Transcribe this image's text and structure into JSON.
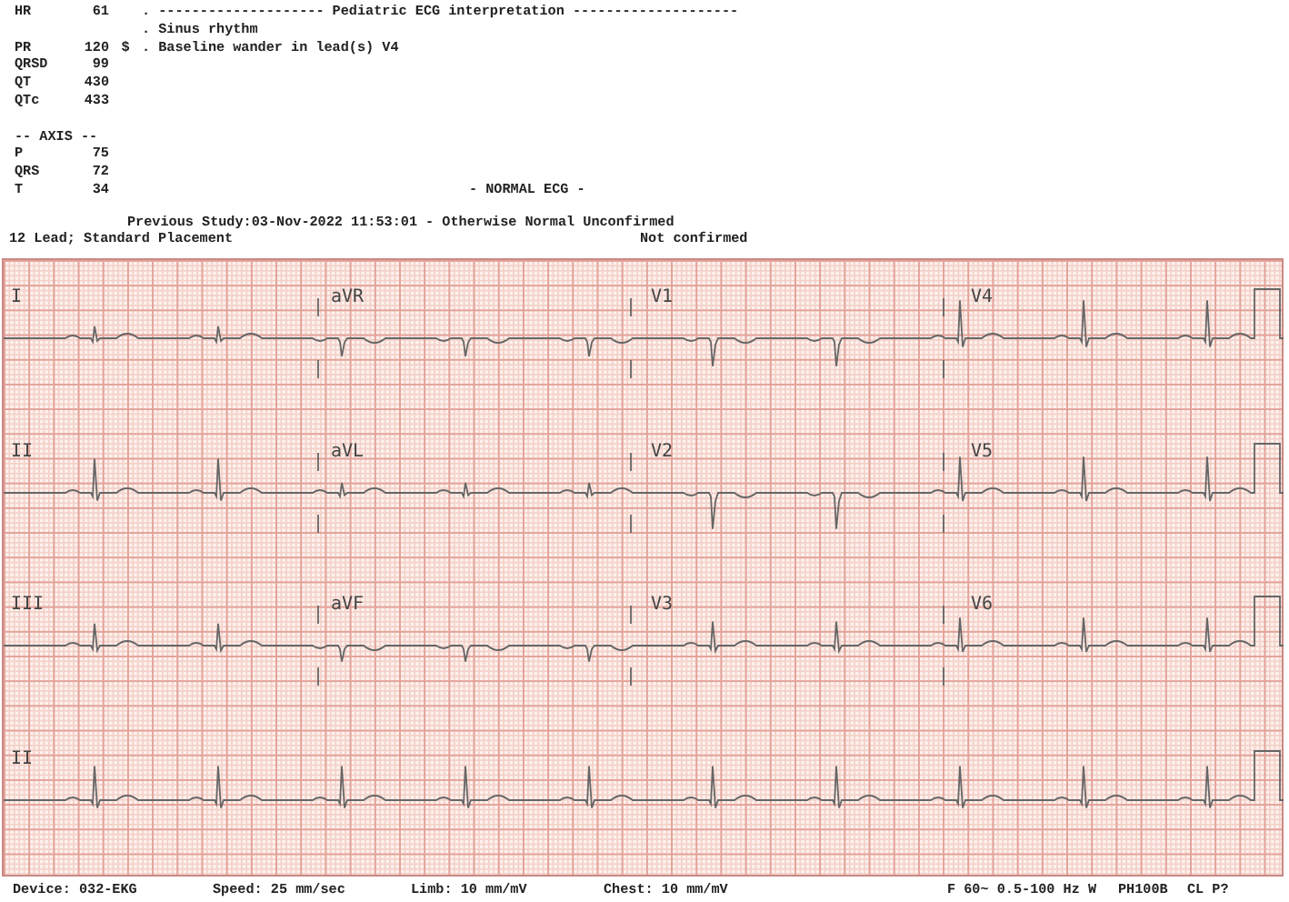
{
  "header": {
    "measurements": [
      {
        "label": "HR",
        "value": "61"
      },
      {
        "label": "PR",
        "value": "120"
      },
      {
        "label": "QRSD",
        "value": "99"
      },
      {
        "label": "QT",
        "value": "430"
      },
      {
        "label": "QTc",
        "value": "433"
      }
    ],
    "interpretation": [
      {
        "text": ". -------------------- Pediatric ECG interpretation --------------------"
      },
      {
        "text": ". Sinus rhythm"
      },
      {
        "flag": "$",
        "text": ". Baseline wander in lead(s) V4"
      }
    ],
    "axis": {
      "title": "-- AXIS --",
      "values": [
        {
          "label": "P",
          "value": "75"
        },
        {
          "label": "QRS",
          "value": "72"
        },
        {
          "label": "T",
          "value": "34"
        }
      ]
    },
    "summary": "- NORMAL ECG -",
    "previous_study": "Previous Study:03-Nov-2022 11:53:01 - Otherwise Normal Unconfirmed",
    "lead_info": "12 Lead; Standard Placement",
    "confirmation": "Not confirmed"
  },
  "strip": {
    "rows": [
      {
        "leads": [
          "I",
          "aVR",
          "V1",
          "V4"
        ]
      },
      {
        "leads": [
          "II",
          "aVL",
          "V2",
          "V5"
        ]
      },
      {
        "leads": [
          "III",
          "aVF",
          "V3",
          "V6"
        ]
      },
      {
        "leads": [
          "II"
        ]
      }
    ]
  },
  "footer": [
    "Device: 032-EKG",
    "Speed: 25 mm/sec",
    "Limb: 10 mm/mV",
    "Chest: 10 mm/mV",
    "F 60~ 0.5-100 Hz W",
    "PH100B",
    "CL P?"
  ]
}
